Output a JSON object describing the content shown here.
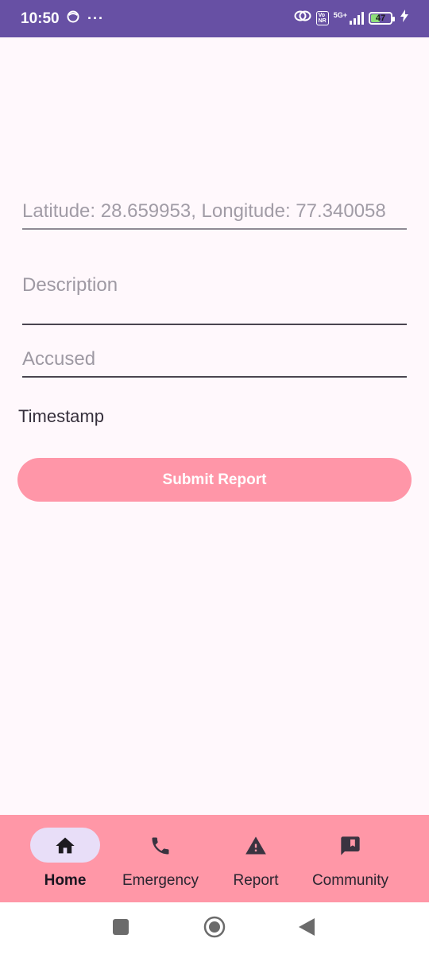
{
  "status_bar": {
    "time": "10:50",
    "dots": "···",
    "vo_label": "Vo\nNR",
    "net_label": "5G+",
    "battery_level": "47",
    "battery_fraction": 0.47,
    "background_color": "#6750A4",
    "icons": [
      "notification-icon",
      "more-dots-icon",
      "link-icon",
      "volte-icon",
      "signal-icon",
      "battery-icon",
      "charging-icon"
    ]
  },
  "form": {
    "location_text": "Latitude: 28.659953, Longitude: 77.340058",
    "description_placeholder": "Description",
    "accused_placeholder": "Accused",
    "timestamp_label": "Timestamp",
    "submit_label": "Submit Report"
  },
  "bottom_nav": {
    "items": [
      {
        "label": "Home",
        "icon": "home-icon",
        "active": true
      },
      {
        "label": "Emergency",
        "icon": "phone-icon",
        "active": false
      },
      {
        "label": "Report",
        "icon": "warning-icon",
        "active": false
      },
      {
        "label": "Community",
        "icon": "feedback-icon",
        "active": false
      }
    ],
    "background_color": "#FF97A7",
    "active_pill_color": "#E8DEF8"
  },
  "system_nav": {
    "icons": [
      "recents-square-icon",
      "home-circle-icon",
      "back-triangle-icon"
    ]
  },
  "colors": {
    "page_background": "#FFF8FC",
    "button_color": "#FF96A8"
  }
}
